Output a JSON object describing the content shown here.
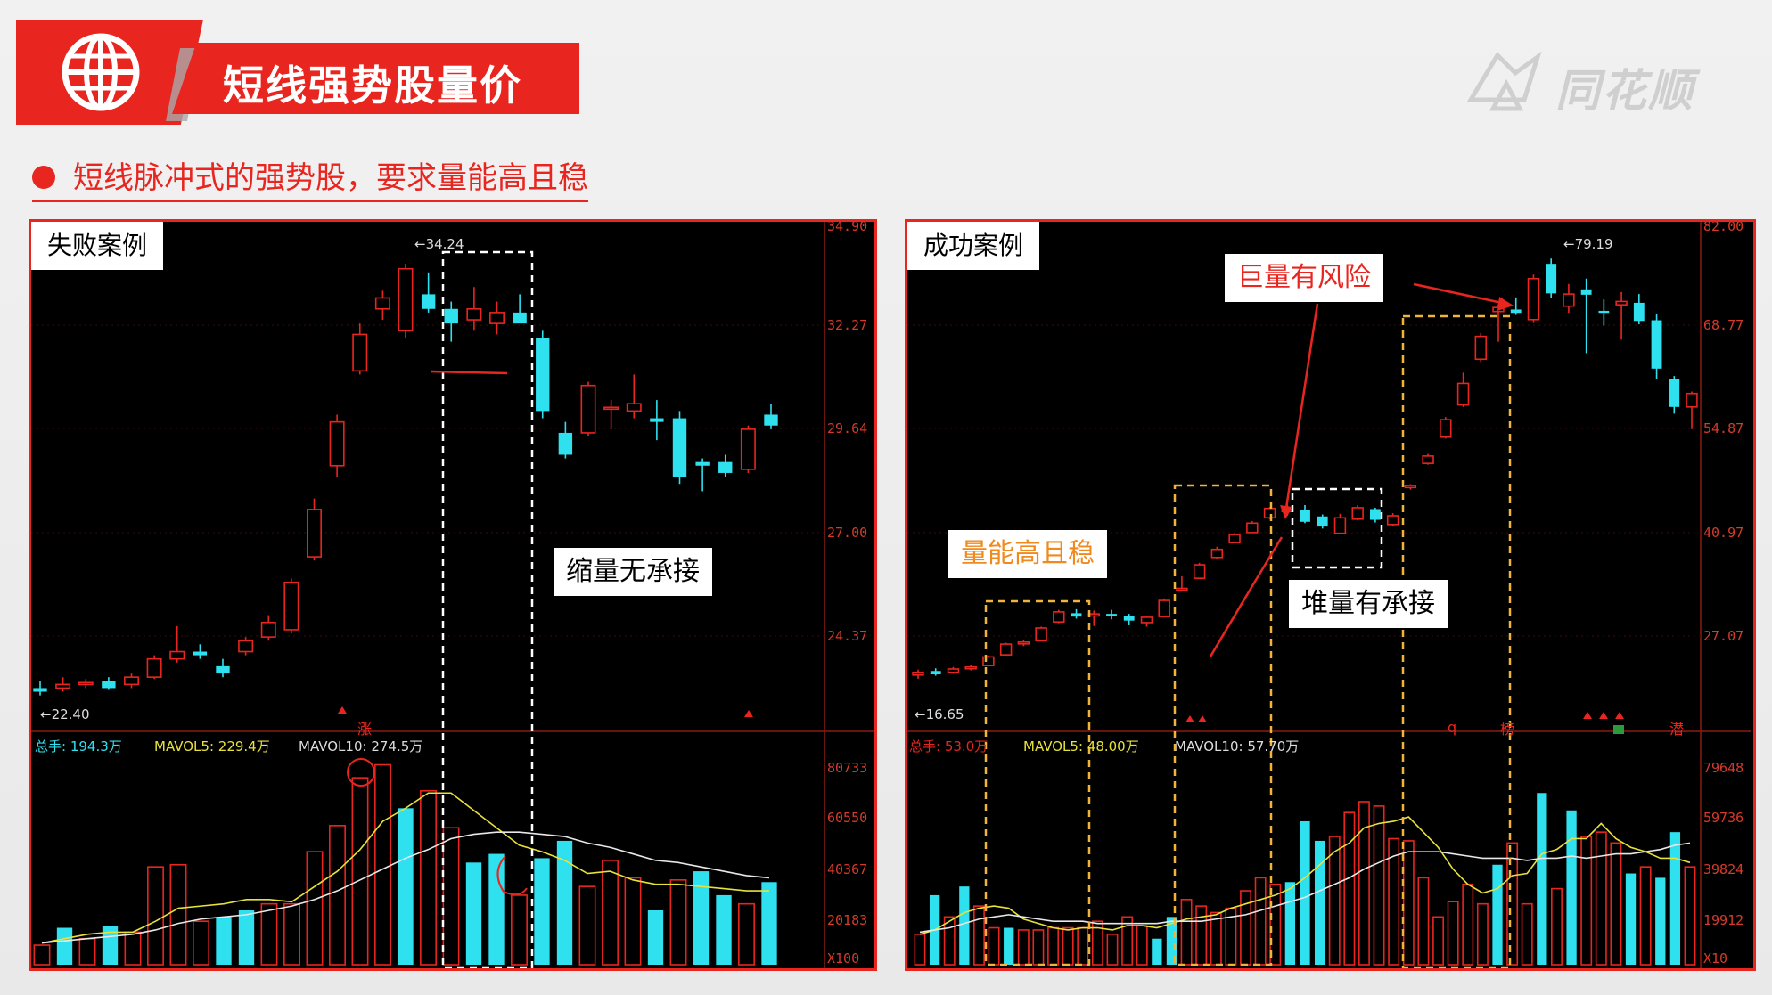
{
  "header": {
    "title": "短线强势股量价",
    "brand": "同花顺"
  },
  "subtitle": "短线脉冲式的强势股，要求量能高且稳",
  "colors": {
    "accent": "#e8251f",
    "up": "#e8251f",
    "down": "#2fe0ef",
    "orange": "#f08a1e"
  },
  "left_panel": {
    "case_label": "失败案例",
    "high_label": "34.24",
    "low_label": "22.40",
    "price_axis": [
      "34.90",
      "32.27",
      "29.64",
      "27.00",
      "24.37"
    ],
    "vol_axis": [
      "80733",
      "60550",
      "40367",
      "20183",
      "X100"
    ],
    "stats": {
      "total": "总手: 194.3万",
      "mavol5": "MAVOL5: 229.4万",
      "mavol10": "MAVOL10: 274.5万"
    },
    "marker": "涨",
    "annotation": "缩量无承接"
  },
  "right_panel": {
    "case_label": "成功案例",
    "high_label": "79.19",
    "low_label": "16.65",
    "price_axis": [
      "82.00",
      "68.77",
      "54.87",
      "40.97",
      "27.07"
    ],
    "vol_axis": [
      "79648",
      "59736",
      "39824",
      "19912",
      "X10"
    ],
    "stats": {
      "total": "总手: 53.0万",
      "mavol5": "MAVOL5: 48.00万",
      "mavol10": "MAVOL10: 57.70万"
    },
    "markers": [
      "q",
      "榜",
      "潜"
    ],
    "annotations": {
      "steady": "量能高且稳",
      "risk": "巨量有风险",
      "support": "堆量有承接"
    }
  },
  "chart_data": [
    {
      "type": "candlestick",
      "title": "失败案例",
      "price_range": [
        22.0,
        34.9
      ],
      "ohlc": [
        [
          22.6,
          22.8,
          22.4,
          22.5
        ],
        [
          22.6,
          22.9,
          22.5,
          22.7
        ],
        [
          22.7,
          22.85,
          22.6,
          22.75
        ],
        [
          22.8,
          22.9,
          22.55,
          22.6
        ],
        [
          22.7,
          23.0,
          22.6,
          22.9
        ],
        [
          22.9,
          23.5,
          22.85,
          23.4
        ],
        [
          23.4,
          24.3,
          23.3,
          23.6
        ],
        [
          23.6,
          23.8,
          23.4,
          23.5
        ],
        [
          23.2,
          23.4,
          22.9,
          23.0
        ],
        [
          23.6,
          24.0,
          23.5,
          23.9
        ],
        [
          24.0,
          24.6,
          23.9,
          24.4
        ],
        [
          24.2,
          25.6,
          24.1,
          25.5
        ],
        [
          26.2,
          27.8,
          26.1,
          27.5
        ],
        [
          28.7,
          30.1,
          28.4,
          29.9
        ],
        [
          31.3,
          32.6,
          31.2,
          32.3
        ],
        [
          33.0,
          33.5,
          32.7,
          33.3
        ],
        [
          32.4,
          34.24,
          32.2,
          34.1
        ],
        [
          33.4,
          34.0,
          32.9,
          33.0
        ],
        [
          33.0,
          33.2,
          32.1,
          32.6
        ],
        [
          32.7,
          33.6,
          32.4,
          33.0
        ],
        [
          32.6,
          33.2,
          32.3,
          32.9
        ],
        [
          32.9,
          33.4,
          32.7,
          32.6
        ],
        [
          32.2,
          32.4,
          30.0,
          30.2
        ],
        [
          29.6,
          29.9,
          28.9,
          29.0
        ],
        [
          29.6,
          31.0,
          29.5,
          30.9
        ],
        [
          30.3,
          30.5,
          29.7,
          30.3
        ],
        [
          30.2,
          31.2,
          30.0,
          30.4
        ],
        [
          30.0,
          30.5,
          29.4,
          29.9
        ],
        [
          30.0,
          30.2,
          28.2,
          28.4
        ],
        [
          28.8,
          28.9,
          28.0,
          28.7
        ],
        [
          28.8,
          29.0,
          28.4,
          28.5
        ],
        [
          28.6,
          29.8,
          28.5,
          29.7
        ],
        [
          30.1,
          30.4,
          29.7,
          29.8
        ]
      ],
      "volume": [
        9,
        17,
        12,
        18,
        15,
        45,
        46,
        20,
        22,
        25,
        28,
        28,
        52,
        64,
        86,
        92,
        72,
        80,
        63,
        47,
        51,
        32,
        49,
        57,
        36,
        48,
        40,
        25,
        39,
        43,
        32,
        28,
        38
      ],
      "vol_range": [
        0,
        80733
      ],
      "series": [
        {
          "name": "MAVOL5",
          "values": [
            10,
            12,
            14,
            15,
            15,
            20,
            26,
            27,
            28,
            30,
            30,
            29,
            36,
            43,
            53,
            66,
            72,
            79,
            79,
            71,
            63,
            55,
            52,
            48,
            42,
            43,
            39,
            37,
            37,
            36,
            35,
            34,
            34
          ]
        },
        {
          "name": "MAVOL10",
          "values": [
            10,
            11,
            12,
            13,
            14,
            16,
            19,
            21,
            22,
            23,
            25,
            27,
            30,
            34,
            39,
            44,
            49,
            53,
            58,
            60,
            61,
            61,
            60,
            59,
            56,
            54,
            51,
            48,
            47,
            45,
            43,
            41,
            40
          ]
        }
      ]
    },
    {
      "type": "candlestick",
      "title": "成功案例",
      "price_range": [
        12.0,
        82.0
      ],
      "ohlc": [
        [
          17.2,
          18.0,
          16.65,
          17.6
        ],
        [
          17.8,
          18.2,
          17.1,
          17.3
        ],
        [
          17.6,
          18.4,
          17.4,
          18.1
        ],
        [
          18.2,
          18.7,
          17.9,
          18.4
        ],
        [
          18.6,
          20.1,
          18.5,
          19.9
        ],
        [
          20.2,
          22.0,
          20.1,
          21.8
        ],
        [
          22.0,
          22.4,
          21.5,
          22.1
        ],
        [
          22.3,
          24.4,
          22.2,
          24.2
        ],
        [
          25.1,
          26.9,
          24.9,
          26.6
        ],
        [
          26.4,
          27.0,
          25.6,
          25.9
        ],
        [
          26.0,
          26.8,
          24.5,
          26.3
        ],
        [
          26.3,
          26.9,
          25.5,
          26.0
        ],
        [
          26.0,
          26.3,
          24.6,
          25.3
        ],
        [
          25.0,
          26.0,
          24.4,
          25.8
        ],
        [
          25.9,
          28.6,
          25.8,
          28.3
        ],
        [
          29.9,
          31.9,
          29.6,
          30.1
        ],
        [
          31.6,
          33.9,
          31.5,
          33.6
        ],
        [
          34.7,
          36.3,
          34.5,
          35.9
        ],
        [
          36.9,
          38.3,
          36.8,
          38.1
        ],
        [
          38.4,
          40.1,
          38.3,
          39.8
        ],
        [
          40.6,
          42.2,
          40.4,
          42.0
        ],
        [
          41.6,
          42.9,
          40.9,
          41.8
        ],
        [
          41.8,
          42.5,
          39.8,
          40.0
        ],
        [
          40.8,
          41.1,
          39.0,
          39.3
        ],
        [
          38.3,
          41.2,
          38.2,
          40.6
        ],
        [
          40.4,
          42.5,
          40.2,
          42.1
        ],
        [
          41.9,
          42.1,
          39.9,
          40.3
        ],
        [
          39.6,
          41.3,
          39.3,
          40.9
        ],
        [
          45.1,
          45.6,
          44.8,
          45.4
        ],
        [
          48.7,
          50.1,
          48.5,
          49.8
        ],
        [
          52.6,
          55.6,
          52.4,
          55.2
        ],
        [
          57.4,
          62.2,
          57.1,
          60.6
        ],
        [
          64.2,
          68.1,
          63.8,
          67.6
        ],
        [
          71.3,
          72.4,
          66.8,
          71.9
        ],
        [
          71.6,
          73.4,
          70.8,
          71.1
        ],
        [
          70.1,
          76.8,
          69.6,
          76.2
        ],
        [
          78.4,
          79.19,
          73.3,
          74.0
        ],
        [
          72.1,
          75.4,
          71.1,
          73.9
        ],
        [
          74.6,
          76.2,
          65.1,
          73.8
        ],
        [
          71.4,
          73.1,
          69.2,
          71.1
        ],
        [
          72.3,
          74.2,
          67.1,
          72.8
        ],
        [
          72.6,
          73.9,
          69.4,
          69.9
        ],
        [
          70.0,
          71.0,
          61.3,
          62.8
        ],
        [
          61.3,
          61.7,
          56.1,
          57.1
        ],
        [
          57.1,
          59.4,
          53.8,
          59.1
        ]
      ],
      "volume": [
        14,
        32,
        22,
        36,
        27,
        17,
        17,
        16,
        16,
        17,
        17,
        17,
        20,
        14,
        22,
        18,
        12,
        22,
        30,
        27,
        24,
        26,
        34,
        40,
        37,
        38,
        66,
        57,
        59,
        70,
        75,
        73,
        58,
        57,
        40,
        22,
        29,
        37,
        28,
        46,
        56,
        28,
        79,
        35,
        71,
        59,
        61,
        56,
        42,
        45,
        40,
        61,
        45
      ],
      "vol_range": [
        0,
        79648
      ],
      "series": [
        {
          "name": "MAVOL5",
          "values": [
            14,
            16,
            20,
            24,
            26,
            27,
            26,
            21,
            19,
            17,
            16,
            17,
            17,
            16,
            18,
            18,
            17,
            19,
            21,
            22,
            23,
            26,
            28,
            30,
            32,
            35,
            40,
            46,
            52,
            56,
            63,
            65,
            66,
            68,
            61,
            54,
            44,
            37,
            33,
            35,
            41,
            42,
            51,
            53,
            58,
            58,
            65,
            58,
            54,
            52,
            49,
            49,
            47
          ]
        },
        {
          "name": "MAVOL10",
          "values": [
            15,
            16,
            17,
            19,
            21,
            22,
            23,
            22,
            21,
            20,
            20,
            20,
            19,
            19,
            19,
            19,
            19,
            20,
            20,
            20,
            21,
            22,
            23,
            25,
            27,
            29,
            31,
            34,
            37,
            40,
            44,
            47,
            50,
            52,
            52,
            52,
            51,
            50,
            49,
            49,
            49,
            48,
            49,
            49,
            50,
            49,
            50,
            51,
            51,
            52,
            53,
            55,
            56
          ]
        }
      ]
    }
  ]
}
